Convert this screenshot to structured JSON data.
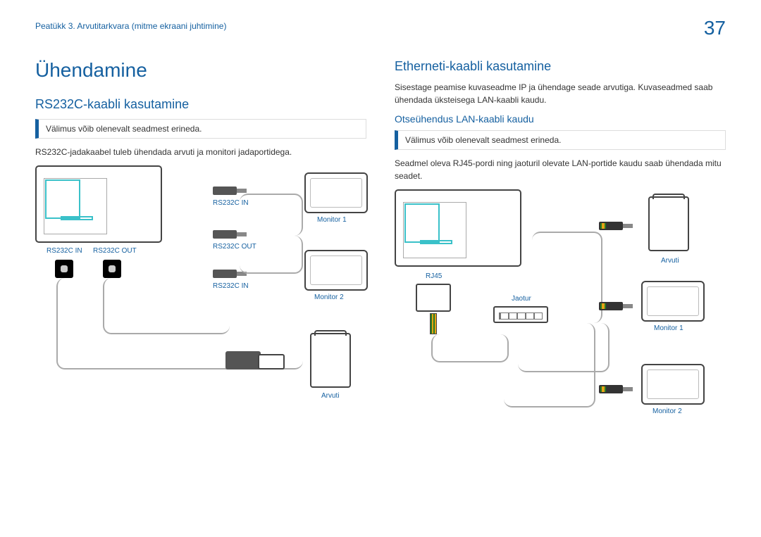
{
  "header": {
    "chapter": "Peatükk 3. Arvutitarkvara (mitme ekraani juhtimine)",
    "page": "37"
  },
  "left": {
    "title": "Ühendamine",
    "h2": "RS232C-kaabli kasutamine",
    "note": "Välimus võib olenevalt seadmest erineda.",
    "para": "RS232C-jadakaabel tuleb ühendada arvuti ja monitori jadaportidega.",
    "labels": {
      "rs232c_in": "RS232C IN",
      "rs232c_out": "RS232C OUT",
      "monitor1": "Monitor 1",
      "monitor2": "Monitor 2",
      "arvuti": "Arvuti"
    }
  },
  "right": {
    "h2": "Etherneti-kaabli kasutamine",
    "para1": "Sisestage peamise kuvaseadme IP ja ühendage seade arvutiga. Kuvaseadmed saab ühendada üksteisega LAN-kaabli kaudu.",
    "h3": "Otseühendus LAN-kaabli kaudu",
    "note": "Välimus võib olenevalt seadmest erineda.",
    "para2": "Seadmel oleva RJ45-pordi ning jaoturil olevate LAN-portide kaudu saab ühendada mitu seadet.",
    "labels": {
      "rj45": "RJ45",
      "jaotur": "Jaotur",
      "arvuti": "Arvuti",
      "monitor1": "Monitor 1",
      "monitor2": "Monitor 2"
    }
  }
}
